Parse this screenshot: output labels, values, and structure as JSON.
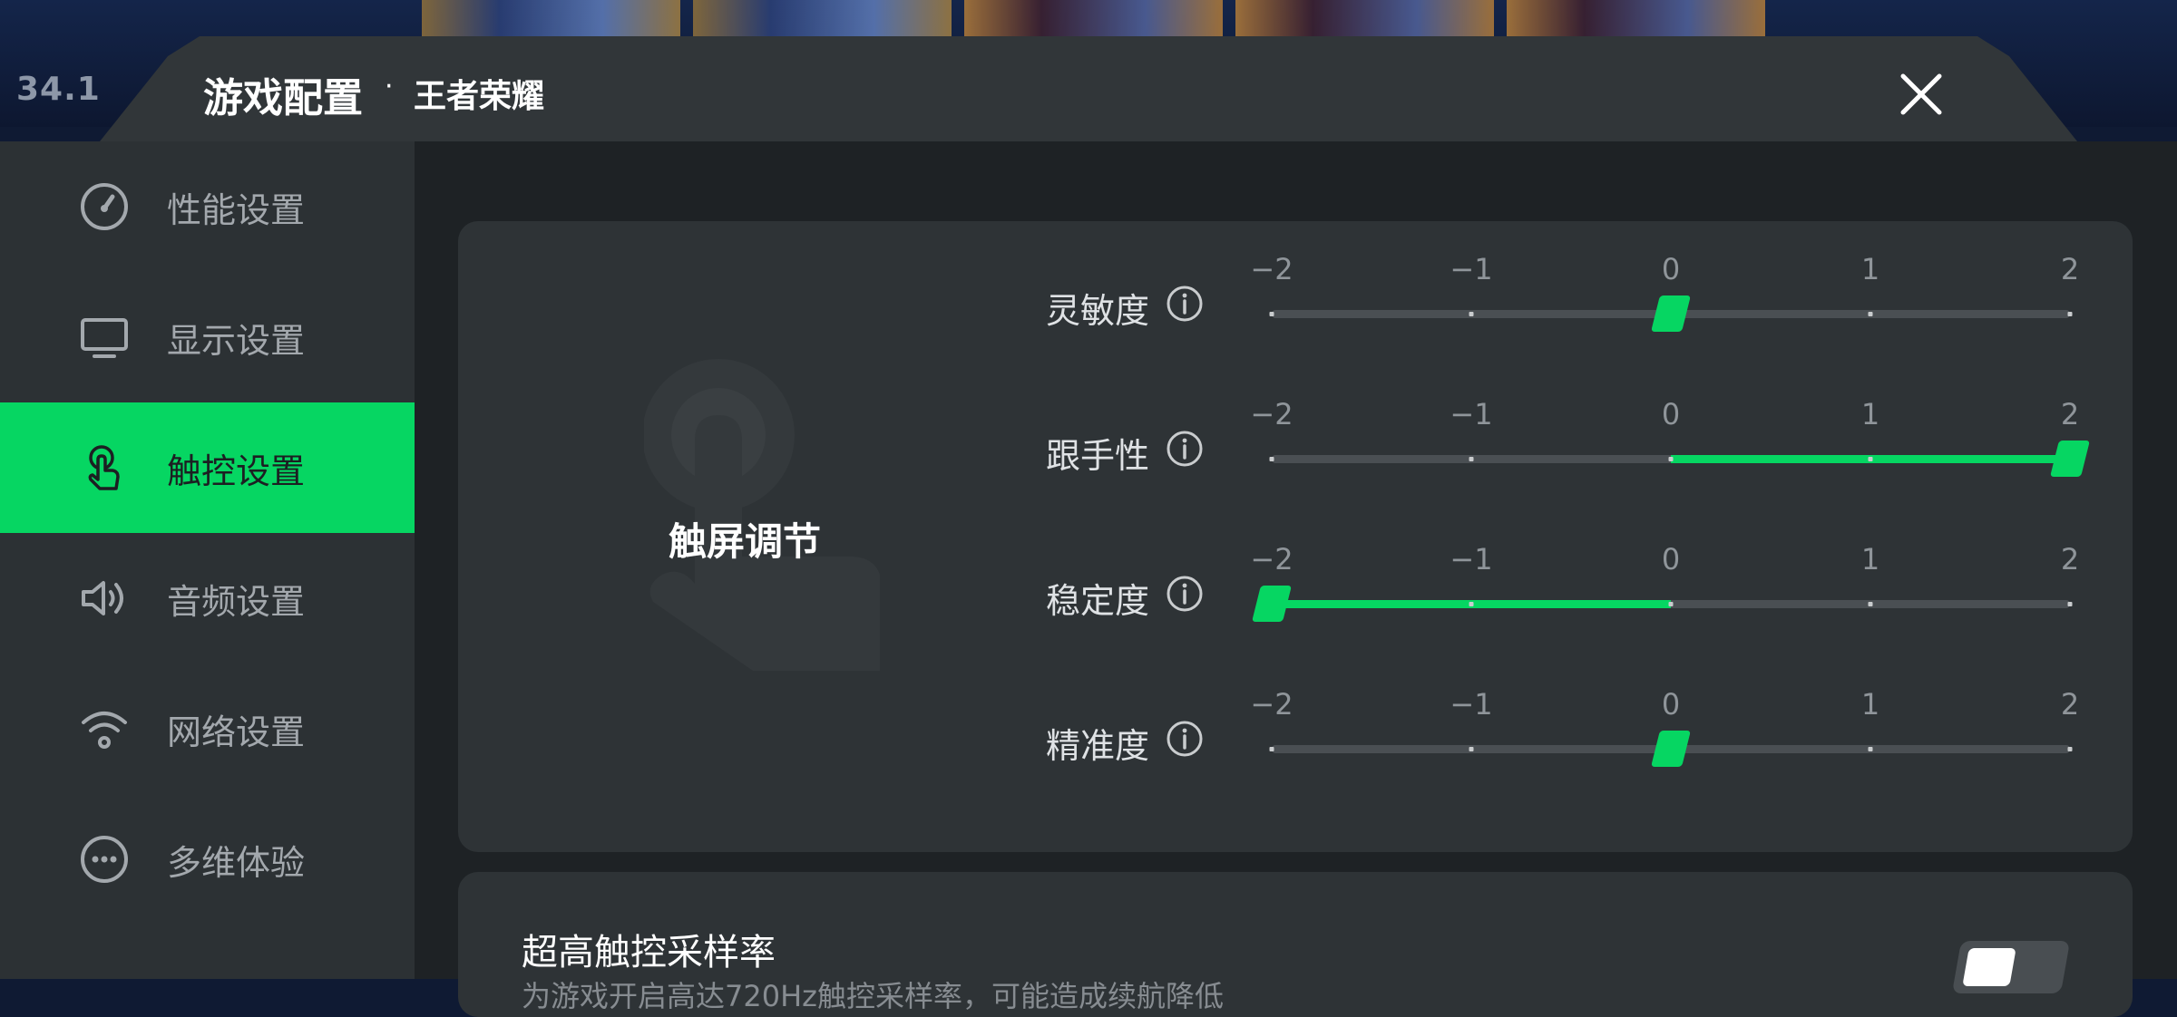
{
  "background": {
    "fps_readout": "34.1"
  },
  "header": {
    "title": "游戏配置",
    "separator": "·",
    "subtitle": "王者荣耀",
    "close_icon": "close-icon"
  },
  "sidebar": {
    "items": [
      {
        "label": "性能设置",
        "icon": "gauge-icon",
        "active": false
      },
      {
        "label": "显示设置",
        "icon": "monitor-icon",
        "active": false
      },
      {
        "label": "触控设置",
        "icon": "touch-icon",
        "active": true
      },
      {
        "label": "音频设置",
        "icon": "speaker-icon",
        "active": false
      },
      {
        "label": "网络设置",
        "icon": "wifi-icon",
        "active": false
      },
      {
        "label": "多维体验",
        "icon": "more-icon",
        "active": false
      }
    ]
  },
  "touch_panel": {
    "title": "触屏调节",
    "tick_labels": [
      "−2",
      "−1",
      "0",
      "1",
      "2"
    ],
    "sliders": [
      {
        "label": "灵敏度",
        "value": 0
      },
      {
        "label": "跟手性",
        "value": 2
      },
      {
        "label": "稳定度",
        "value": -2
      },
      {
        "label": "精准度",
        "value": 0
      }
    ]
  },
  "sampling": {
    "title": "超高触控采样率",
    "description": "为游戏开启高达720Hz触控采样率，可能造成续航降低",
    "enabled": false
  },
  "colors": {
    "accent": "#06d662",
    "panel": "#2e3336",
    "sidebar": "#2c3134",
    "background": "#1e2225"
  }
}
